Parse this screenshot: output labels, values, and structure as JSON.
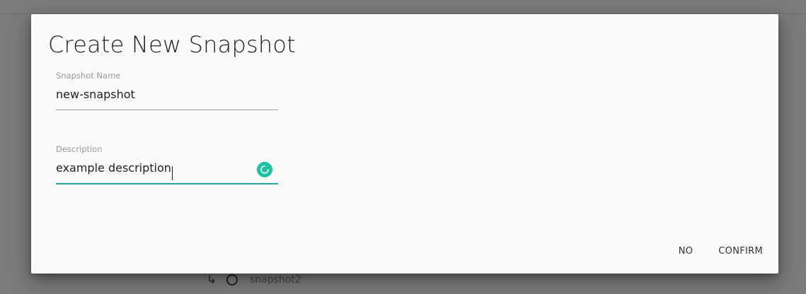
{
  "background": {
    "list_item": {
      "icon": "subdirectory-arrow-right-icon",
      "node_icon": "circle-outline-icon",
      "name": "snapshot2"
    }
  },
  "dialog": {
    "title": "Create New Snapshot",
    "fields": {
      "snapshot_name": {
        "label": "Snapshot Name",
        "value": "new-snapshot"
      },
      "description": {
        "label": "Description",
        "value": "example description",
        "status_icon": "loading-spinner-icon"
      }
    },
    "actions": {
      "no_label": "NO",
      "confirm_label": "CONFIRM"
    }
  },
  "colors": {
    "accent": "#26a69a",
    "status_icon_bg": "#1dc2a0",
    "backdrop": "#7b7b7b"
  }
}
